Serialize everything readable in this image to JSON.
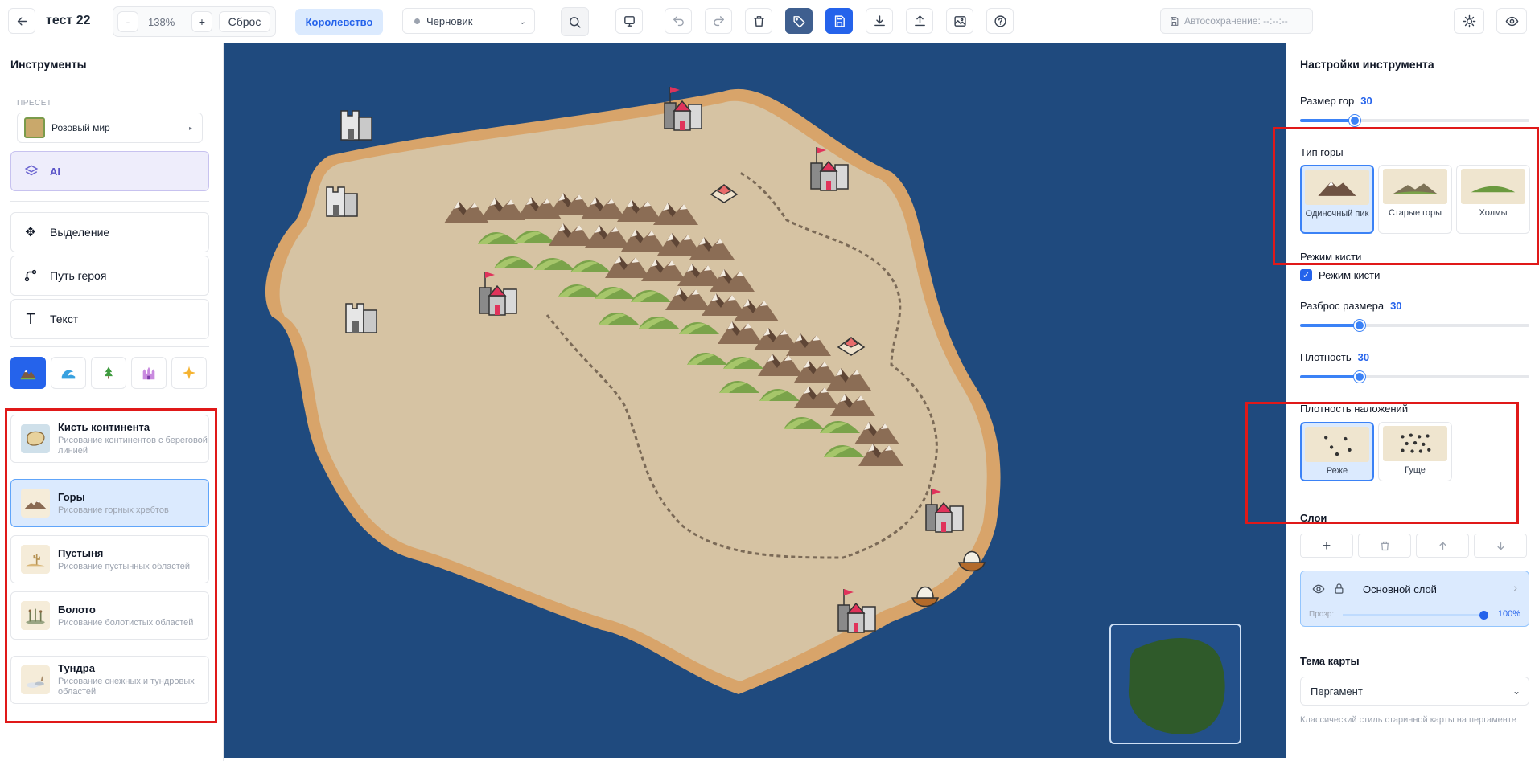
{
  "header": {
    "title": "тест 22",
    "zoom_minus": "-",
    "zoom": "138%",
    "zoom_plus": "+",
    "reset": "Сброс",
    "kingdom": "Королевство",
    "status": "Черновик",
    "autosave": "Автосохранение: --:--:--"
  },
  "left": {
    "tools_title": "Инструменты",
    "preset_label": "ПРЕСЕТ",
    "preset_value": "Розовый мир",
    "ai": "AI",
    "tools": [
      {
        "label": "Выделение"
      },
      {
        "label": "Путь героя"
      },
      {
        "label": "Текст"
      }
    ],
    "brushes": [
      {
        "title": "Кисть континента",
        "sub": "Рисование континентов с береговой линией"
      },
      {
        "title": "Горы",
        "sub": "Рисование горных хребтов"
      },
      {
        "title": "Пустыня",
        "sub": "Рисование пустынных областей"
      },
      {
        "title": "Болото",
        "sub": "Рисование болотистых областей"
      },
      {
        "title": "Тундра",
        "sub": "Рисование снежных и тундровых областей"
      }
    ]
  },
  "right": {
    "title": "Настройки инструмента",
    "mountain_size": {
      "label": "Размер гор",
      "value": "30",
      "level": 0.24
    },
    "mountain_type": {
      "label": "Тип горы",
      "options": [
        "Одиночный пик",
        "Старые горы",
        "Холмы"
      ]
    },
    "brush_mode": {
      "label": "Режим кисти",
      "checkbox": "Режим кисти",
      "checked": true
    },
    "size_spread": {
      "label": "Разброс размера",
      "value": "30",
      "level": 0.3
    },
    "density": {
      "label": "Плотность",
      "value": "30",
      "level": 0.3
    },
    "overlay_density": {
      "label": "Плотность наложений",
      "options": [
        "Реже",
        "Гуще"
      ]
    },
    "layers": {
      "label": "Слои",
      "layer_name": "Основной слой",
      "opacity_label": "Прозр:",
      "opacity_value": "100%"
    },
    "theme": {
      "label": "Тема карты",
      "value": "Пергамент",
      "desc": "Классический стиль старинной карты на пергаменте"
    }
  },
  "colors": {
    "accent": "#2563eb",
    "ocean": "#1f4a7e",
    "land": "#d6c3a3",
    "coast": "#d8a46a",
    "highlight": "#e01919"
  }
}
